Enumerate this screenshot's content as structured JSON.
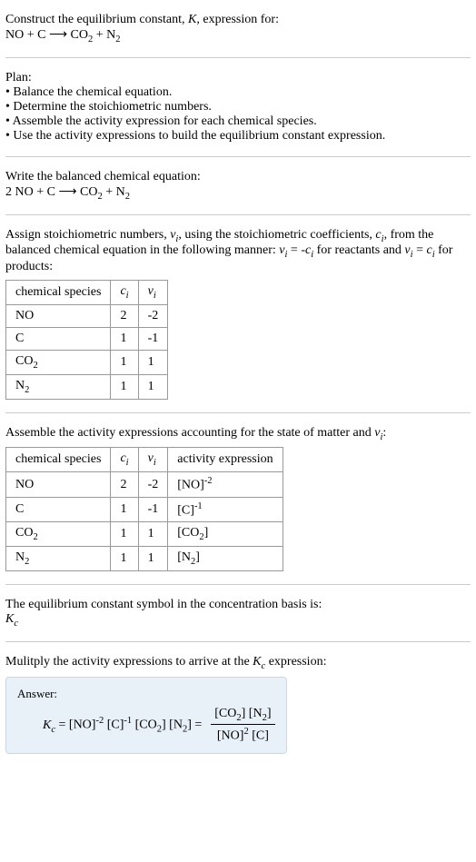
{
  "title_line1": "Construct the equilibrium constant, K, expression for:",
  "title_equation": "NO + C ⟶ CO₂ + N₂",
  "plan_header": "Plan:",
  "plan_items": [
    "Balance the chemical equation.",
    "Determine the stoichiometric numbers.",
    "Assemble the activity expression for each chemical species.",
    "Use the activity expressions to build the equilibrium constant expression."
  ],
  "balanced_header": "Write the balanced chemical equation:",
  "balanced_equation": "2 NO + C ⟶ CO₂ + N₂",
  "assign_text1": "Assign stoichiometric numbers, νᵢ, using the stoichiometric coefficients, cᵢ, from the balanced chemical equation in the following manner: νᵢ = -cᵢ for reactants and νᵢ = cᵢ for products:",
  "table1": {
    "headers": [
      "chemical species",
      "cᵢ",
      "νᵢ"
    ],
    "rows": [
      [
        "NO",
        "2",
        "-2"
      ],
      [
        "C",
        "1",
        "-1"
      ],
      [
        "CO₂",
        "1",
        "1"
      ],
      [
        "N₂",
        "1",
        "1"
      ]
    ]
  },
  "assemble_text": "Assemble the activity expressions accounting for the state of matter and νᵢ:",
  "table2": {
    "headers": [
      "chemical species",
      "cᵢ",
      "νᵢ",
      "activity expression"
    ],
    "rows": [
      [
        "NO",
        "2",
        "-2",
        "[NO]⁻²"
      ],
      [
        "C",
        "1",
        "-1",
        "[C]⁻¹"
      ],
      [
        "CO₂",
        "1",
        "1",
        "[CO₂]"
      ],
      [
        "N₂",
        "1",
        "1",
        "[N₂]"
      ]
    ]
  },
  "symbol_text": "The equilibrium constant symbol in the concentration basis is:",
  "symbol_value": "K_c",
  "multiply_text": "Mulitply the activity expressions to arrive at the K_c expression:",
  "answer_label": "Answer:",
  "answer_lhs": "K_c = [NO]⁻² [C]⁻¹ [CO₂] [N₂] = ",
  "answer_num": "[CO₂] [N₂]",
  "answer_den": "[NO]² [C]"
}
